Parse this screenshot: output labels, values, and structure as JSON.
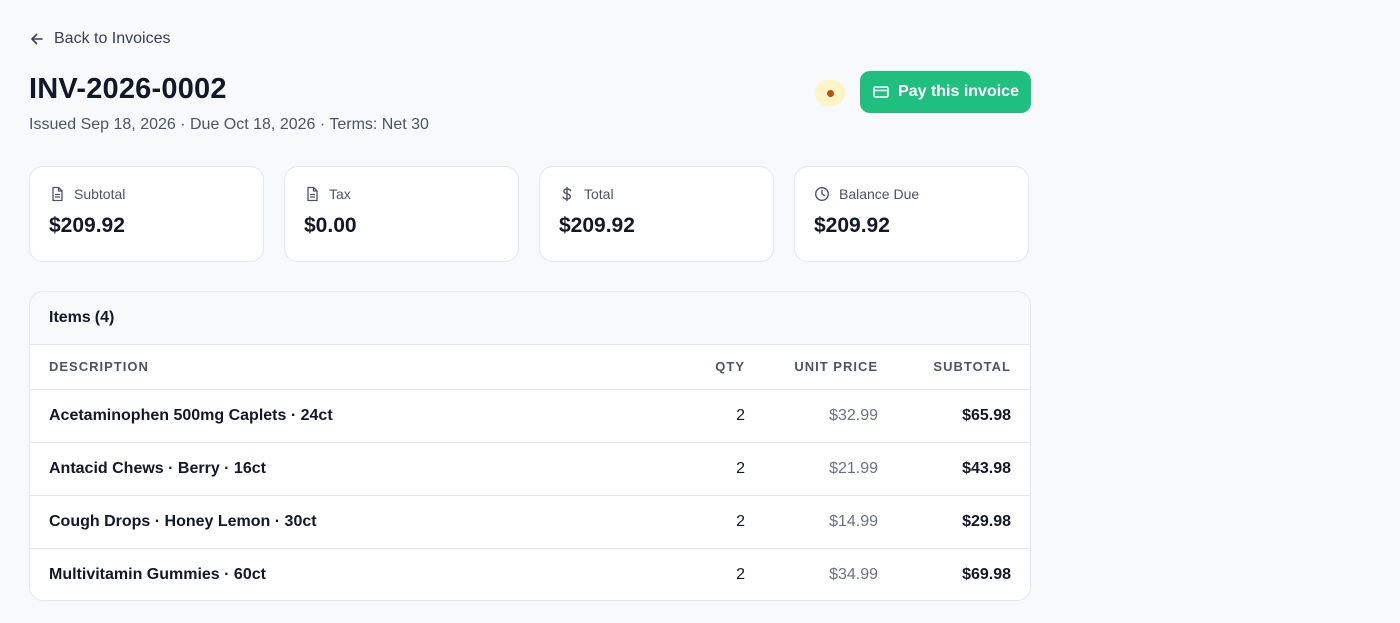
{
  "back_link": {
    "label": "Back to Invoices"
  },
  "invoice": {
    "number": "INV-2026-0002",
    "meta": "Issued Sep 18, 2026 · Due Oct 18, 2026 · Terms: Net 30"
  },
  "status": {
    "color": "#b45309"
  },
  "pay_button": {
    "label": "Pay this invoice",
    "icon": "credit-card-icon",
    "color": "#1fbf7f"
  },
  "summary": [
    {
      "label": "Subtotal",
      "value": "$209.92",
      "icon": "document-icon"
    },
    {
      "label": "Tax",
      "value": "$0.00",
      "icon": "document-icon"
    },
    {
      "label": "Total",
      "value": "$209.92",
      "icon": "dollar-icon"
    },
    {
      "label": "Balance Due",
      "value": "$209.92",
      "icon": "clock-icon"
    }
  ],
  "items": {
    "title": "Items",
    "count": "(4)",
    "columns": {
      "description": "DESCRIPTION",
      "qty": "QTY",
      "unit_price": "UNIT PRICE",
      "subtotal": "SUBTOTAL"
    },
    "rows": [
      {
        "description": "Acetaminophen 500mg Caplets · 24ct",
        "qty": "2",
        "unit_price": "$32.99",
        "subtotal": "$65.98"
      },
      {
        "description": "Antacid Chews · Berry · 16ct",
        "qty": "2",
        "unit_price": "$21.99",
        "subtotal": "$43.98"
      },
      {
        "description": "Cough Drops · Honey Lemon · 30ct",
        "qty": "2",
        "unit_price": "$14.99",
        "subtotal": "$29.98"
      },
      {
        "description": "Multivitamin Gummies · 60ct",
        "qty": "2",
        "unit_price": "$34.99",
        "subtotal": "$69.98"
      }
    ]
  }
}
